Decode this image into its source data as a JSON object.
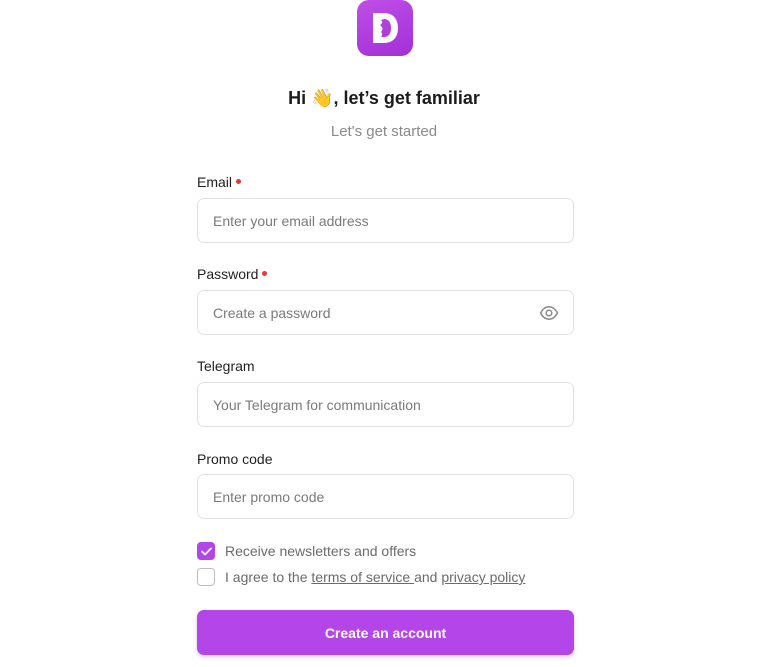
{
  "brand": {
    "logo_icon": "d-letter-logo-icon",
    "colors": {
      "accent": "#b445e8",
      "logo_gradient_start": "#c04ee8",
      "logo_gradient_end": "#a230d6",
      "required_dot": "#e23a3a"
    }
  },
  "header": {
    "title": "Hi 👋, let’s get familiar",
    "subtitle": "Let's get started"
  },
  "form": {
    "email": {
      "label": "Email",
      "required": true,
      "value": "",
      "placeholder": "Enter your email address"
    },
    "password": {
      "label": "Password",
      "required": true,
      "value": "",
      "placeholder": "Create a password",
      "toggle_icon": "eye-icon"
    },
    "telegram": {
      "label": "Telegram",
      "required": false,
      "value": "",
      "placeholder": "Your Telegram for communication"
    },
    "promo": {
      "label": "Promo code",
      "required": false,
      "value": "",
      "placeholder": "Enter promo code"
    },
    "newsletter": {
      "label": "Receive newsletters and offers",
      "checked": true
    },
    "agree": {
      "prefix": "I agree to the ",
      "terms_link": "terms of service ",
      "middle": "and ",
      "privacy_link": "privacy policy",
      "checked": false
    },
    "submit_label": "Create an account"
  }
}
